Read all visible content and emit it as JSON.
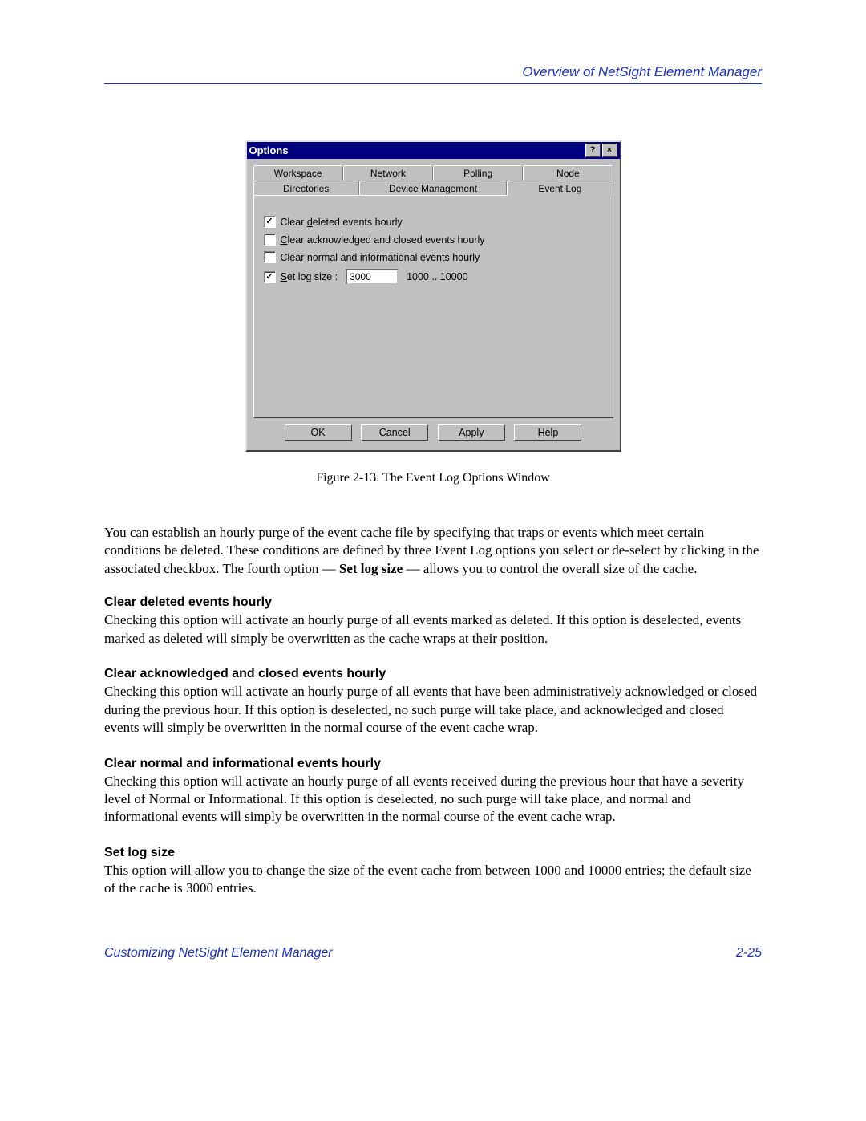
{
  "header_text": "Overview of NetSight Element Manager",
  "window": {
    "title": "Options",
    "help_icon": "?",
    "close_icon": "×",
    "tabs_row1": [
      "Workspace",
      "Network",
      "Polling",
      "Node"
    ],
    "tabs_row2": [
      "Directories",
      "Device Management",
      "Event Log"
    ],
    "options": {
      "opt1_prefix": "Clear ",
      "opt1_hot": "d",
      "opt1_rest": "eleted events hourly",
      "opt2_hot": "C",
      "opt2_rest": "lear acknowledged and closed events hourly",
      "opt3_prefix": "Clear ",
      "opt3_hot": "n",
      "opt3_rest": "ormal and informational events hourly",
      "opt4_hot": "S",
      "opt4_rest": "et log size :",
      "log_size_value": "3000",
      "log_size_range": "1000 .. 10000"
    },
    "buttons": {
      "ok": "OK",
      "cancel": "Cancel",
      "apply_hot": "A",
      "apply_rest": "pply",
      "help_hot": "H",
      "help_rest": "elp"
    }
  },
  "figure_caption": "Figure 2-13. The Event Log Options Window",
  "paragraph1_a": "You can establish an hourly purge of the event cache file by specifying that traps or events which meet certain conditions be deleted. These conditions are defined by three Event Log options you select or de-select by clicking in the associated checkbox. The fourth option — ",
  "paragraph1_bold": "Set log size",
  "paragraph1_b": " — allows you to control the overall size of the cache.",
  "sections": [
    {
      "title": "Clear deleted events hourly",
      "body": "Checking this option will activate an hourly purge of all events marked as deleted. If this option is deselected, events marked as deleted will simply be overwritten as the cache wraps at their position."
    },
    {
      "title": "Clear acknowledged and closed events hourly",
      "body": "Checking this option will activate an hourly purge of all events that have been administratively acknowledged or closed during the previous hour. If this option is deselected, no such purge will take place, and acknowledged and closed events will simply be overwritten in the normal course of the event cache wrap."
    },
    {
      "title": "Clear normal and informational events hourly",
      "body": "Checking this option will activate an hourly purge of all events received during the previous hour that have a severity level of Normal or Informational. If this option is deselected, no such purge will take place, and normal and informational events will simply be overwritten in the normal course of the event cache wrap."
    },
    {
      "title": "Set log size",
      "body": "This option will allow you to change the size of the event cache from between 1000 and 10000 entries; the default size of the cache is 3000 entries."
    }
  ],
  "footer_left": "Customizing NetSight Element Manager",
  "footer_right": "2-25"
}
